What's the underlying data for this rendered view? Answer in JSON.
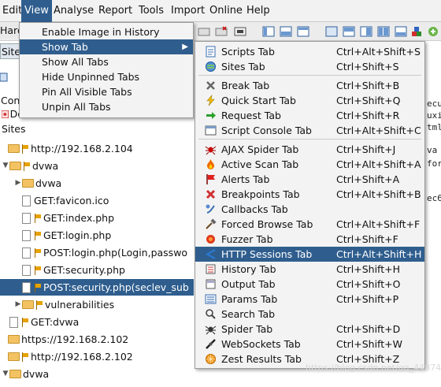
{
  "menubar": {
    "items": [
      {
        "label": "Edit",
        "underline": 0
      },
      {
        "label": "View",
        "underline": 0,
        "active": true
      },
      {
        "label": "Analyse",
        "underline": 0
      },
      {
        "label": "Report",
        "underline": 0
      },
      {
        "label": "Tools",
        "underline": 0
      },
      {
        "label": "Import",
        "underline": 0
      },
      {
        "label": "Online",
        "underline": 0
      },
      {
        "label": "Help",
        "underline": 0
      }
    ]
  },
  "left_panel": {
    "mode_label": "Hard",
    "sites_tab": "Sites",
    "contexts_label": "Cont",
    "default_context_label": "De",
    "sites_root": "Sites",
    "tree": [
      {
        "text": "http://192.168.2.104",
        "indent": 0,
        "expander": "",
        "icon": "folder-flag"
      },
      {
        "text": "dvwa",
        "indent": 1,
        "expander": "▼",
        "icon": "folder-flag"
      },
      {
        "text": "dvwa",
        "indent": 2,
        "expander": "▶",
        "icon": "folder"
      },
      {
        "text": "GET:favicon.ico",
        "indent": 2,
        "expander": "",
        "icon": "page"
      },
      {
        "text": "GET:index.php",
        "indent": 2,
        "expander": "",
        "icon": "page-flag"
      },
      {
        "text": "GET:login.php",
        "indent": 2,
        "expander": "",
        "icon": "page-flag"
      },
      {
        "text": "POST:login.php(Login,passwo",
        "indent": 2,
        "expander": "",
        "icon": "page-flag"
      },
      {
        "text": "GET:security.php",
        "indent": 2,
        "expander": "",
        "icon": "page-flag"
      },
      {
        "text": "POST:security.php(seclev_sub",
        "indent": 2,
        "expander": "",
        "icon": "page-flag",
        "selected": true
      },
      {
        "text": "vulnerabilities",
        "indent": 2,
        "expander": "▶",
        "icon": "folder-flag"
      },
      {
        "text": "GET:dvwa",
        "indent": 1,
        "expander": "",
        "icon": "page-flag"
      },
      {
        "text": "https://192.168.2.102",
        "indent": 0,
        "expander": "",
        "icon": "folder"
      },
      {
        "text": "http://192.168.2.102",
        "indent": 0,
        "expander": "",
        "icon": "folder-flag"
      },
      {
        "text": "dvwa",
        "indent": 1,
        "expander": "▼",
        "icon": "folder"
      }
    ]
  },
  "right_pane_fragments": [
    "ecu",
    "uxi",
    "tml",
    "va",
    "for",
    "ec6"
  ],
  "view_menu": {
    "items": [
      {
        "label": "Enable Image in History",
        "has_submenu": false
      },
      {
        "label": "Show Tab",
        "has_submenu": true,
        "highlighted": true
      },
      {
        "label": "Show All Tabs",
        "has_submenu": false
      },
      {
        "label": "Hide Unpinned Tabs",
        "has_submenu": false
      },
      {
        "label": "Pin All Visible Tabs",
        "has_submenu": false
      },
      {
        "label": "Unpin All Tabs",
        "has_submenu": false
      }
    ],
    "submenu_arrow": "▶"
  },
  "show_tab_submenu": {
    "groups": [
      [
        {
          "label": "Scripts Tab",
          "shortcut": "Ctrl+Alt+Shift+S",
          "icon": "scripts-icon"
        },
        {
          "label": "Sites Tab",
          "shortcut": "Ctrl+Shift+S",
          "icon": "globe-icon"
        }
      ],
      [
        {
          "label": "Break Tab",
          "shortcut": "Ctrl+Shift+B",
          "icon": "break-icon"
        },
        {
          "label": "Quick Start Tab",
          "shortcut": "Ctrl+Shift+Q",
          "icon": "lightning-icon"
        },
        {
          "label": "Request Tab",
          "shortcut": "Ctrl+Shift+R",
          "icon": "arrow-right-icon"
        },
        {
          "label": "Script Console Tab",
          "shortcut": "Ctrl+Alt+Shift+C",
          "icon": "script-console-icon"
        }
      ],
      [
        {
          "label": "AJAX Spider Tab",
          "shortcut": "Ctrl+Shift+J",
          "icon": "spider-red-icon"
        },
        {
          "label": "Active Scan Tab",
          "shortcut": "Ctrl+Alt+Shift+A",
          "icon": "flame-icon"
        },
        {
          "label": "Alerts Tab",
          "shortcut": "Ctrl+Shift+A",
          "icon": "alert-flag-icon"
        },
        {
          "label": "Breakpoints Tab",
          "shortcut": "Ctrl+Alt+Shift+B",
          "icon": "breakpoint-x-icon"
        },
        {
          "label": "Callbacks Tab",
          "shortcut": "",
          "icon": "callbacks-icon"
        },
        {
          "label": "Forced Browse Tab",
          "shortcut": "Ctrl+Alt+Shift+F",
          "icon": "hammer-icon"
        },
        {
          "label": "Fuzzer Tab",
          "shortcut": "Ctrl+Shift+F",
          "icon": "fuzzer-icon"
        },
        {
          "label": "HTTP Sessions Tab",
          "shortcut": "Ctrl+Alt+Shift+H",
          "icon": "sessions-icon",
          "highlighted": true
        },
        {
          "label": "History Tab",
          "shortcut": "Ctrl+Shift+H",
          "icon": "history-icon"
        },
        {
          "label": "Output Tab",
          "shortcut": "Ctrl+Shift+O",
          "icon": "output-icon"
        },
        {
          "label": "Params Tab",
          "shortcut": "Ctrl+Shift+P",
          "icon": "params-icon"
        },
        {
          "label": "Search Tab",
          "shortcut": "",
          "icon": "search-icon"
        },
        {
          "label": "Spider Tab",
          "shortcut": "Ctrl+Shift+D",
          "icon": "spider-icon"
        },
        {
          "label": "WebSockets Tab",
          "shortcut": "Ctrl+Shift+W",
          "icon": "websockets-icon"
        },
        {
          "label": "Zest Results Tab",
          "shortcut": "Ctrl+Shift+Z",
          "icon": "zest-icon"
        }
      ]
    ]
  },
  "watermark": "https://blog.csdn.net/qq_44874645",
  "colors": {
    "highlight": "#2f5e8e",
    "menu_bg": "#f3f3f3"
  }
}
